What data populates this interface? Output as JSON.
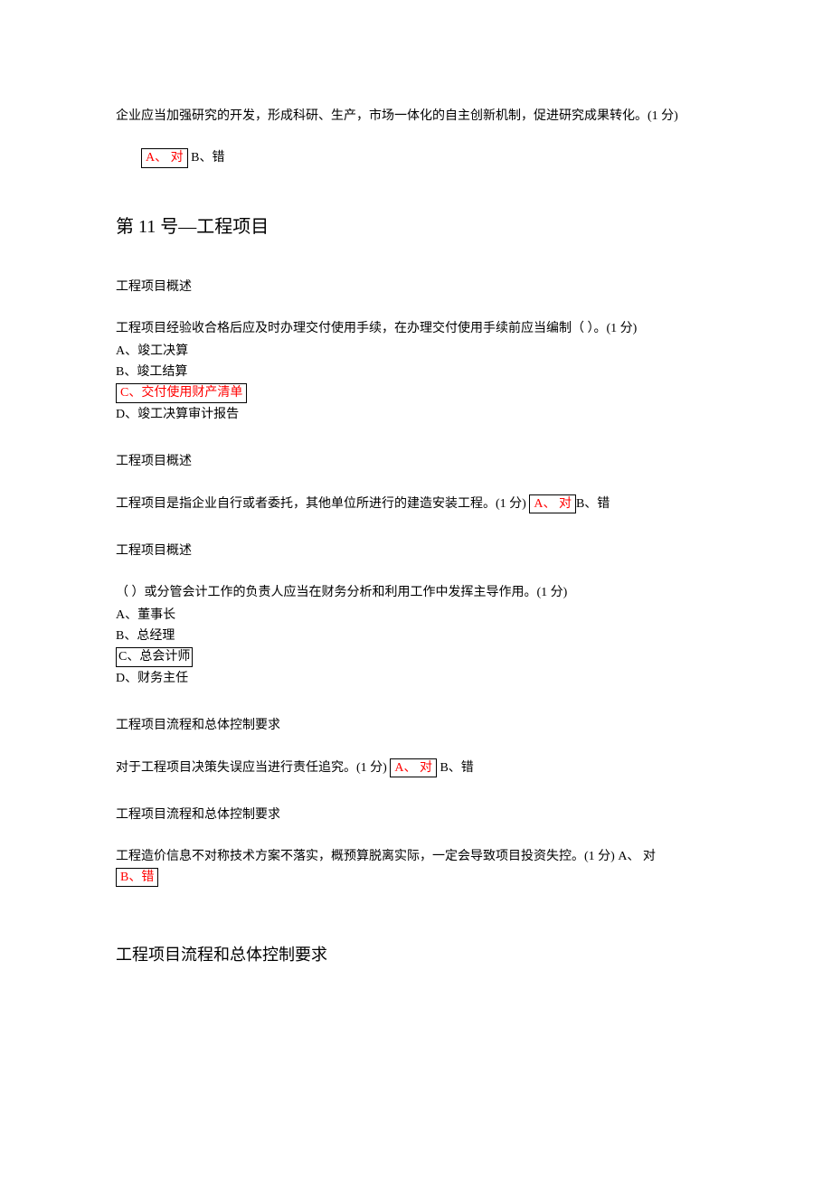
{
  "q1": {
    "text": "企业应当加强研究的开发，形成科研、生产，市场一体化的自主创新机制，促进研究成果转化。(1 分)",
    "optA": "A、  对",
    "optB": " B、错"
  },
  "section1_title": "第 11 号—工程项目",
  "q2": {
    "title": "工程项目概述",
    "text": "工程项目经验收合格后应及时办理交付使用手续，在办理交付使用手续前应当编制（   ）。(1 分)",
    "optA": "A、竣工决算",
    "optB": "B、竣工结算",
    "optC": "C、交付使用财产清单",
    "optD": "D、竣工决算审计报告"
  },
  "q3": {
    "title": "工程项目概述",
    "text_prefix": "工程项目是指企业自行或者委托，其他单位所进行的建造安装工程。(1 分)   ",
    "optA": " A、  对",
    "optB": "B、错"
  },
  "q4": {
    "title": "工程项目概述",
    "text": "（ ）或分管会计工作的负责人应当在财务分析和利用工作中发挥主导作用。(1 分)",
    "optA": "A、董事长",
    "optB": "B、总经理",
    "optC": "C、总会计师",
    "optD": "D、财务主任"
  },
  "q5": {
    "title": "工程项目流程和总体控制要求",
    "text_prefix": "对于工程项目决策失误应当进行责任追究。(1 分)   ",
    "optA": " A、  对 ",
    "optB": " B、错"
  },
  "q6": {
    "title": "工程项目流程和总体控制要求",
    "text_prefix": "工程造价信息不对称技术方案不落实，概预算脱离实际，一定会导致项目投资失控。(1 分)    A、  对 ",
    "optB": "B、错"
  },
  "section2_title": "工程项目流程和总体控制要求"
}
